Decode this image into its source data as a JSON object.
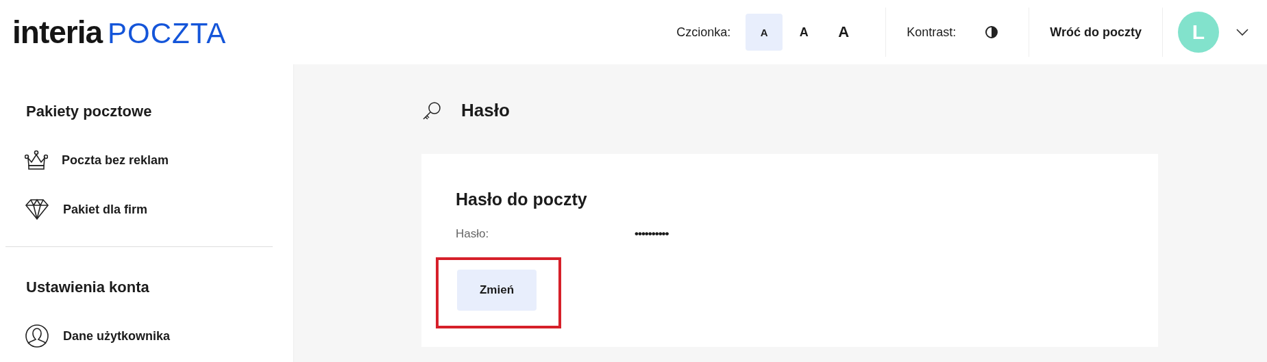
{
  "logo": {
    "brand": "interia",
    "product": "POCZTA"
  },
  "header": {
    "font_label": "Czcionka:",
    "font_sizes": [
      {
        "label": "A",
        "selected": true
      },
      {
        "label": "A",
        "selected": false
      },
      {
        "label": "A",
        "selected": false
      }
    ],
    "contrast_label": "Kontrast:",
    "back_link": "Wróć do poczty",
    "avatar": "L"
  },
  "sidebar": [
    {
      "heading": "Pakiety pocztowe",
      "items": [
        {
          "label": "Poczta bez reklam",
          "kind": "crown"
        },
        {
          "label": "Pakiet dla firm",
          "kind": "diamond"
        }
      ]
    },
    {
      "heading": "Ustawienia konta",
      "items": [
        {
          "label": "Dane użytkownika",
          "kind": "user"
        }
      ]
    }
  ],
  "page_title": "Hasło",
  "card": {
    "title": "Hasło do poczty",
    "field_label": "Hasło:",
    "field_value": "••••••••••",
    "button": "Zmień",
    "button_highlighted": true
  }
}
